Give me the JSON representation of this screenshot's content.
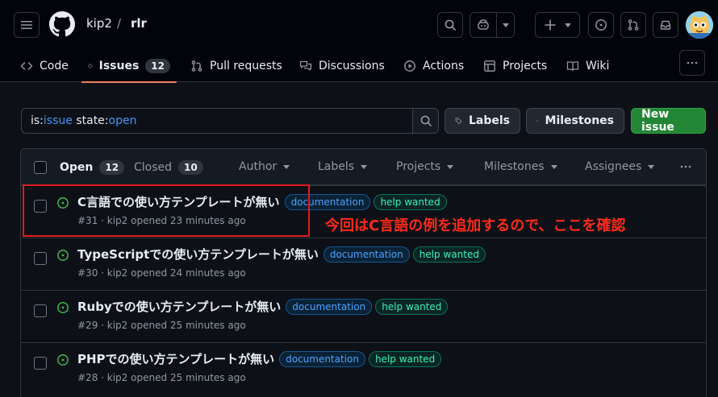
{
  "header": {
    "owner": "kip2",
    "separator": "/",
    "repo": "rlr"
  },
  "repo_nav": {
    "tabs": [
      {
        "label": "Code"
      },
      {
        "label": "Issues",
        "count": "12"
      },
      {
        "label": "Pull requests"
      },
      {
        "label": "Discussions"
      },
      {
        "label": "Actions"
      },
      {
        "label": "Projects"
      },
      {
        "label": "Wiki"
      }
    ]
  },
  "search": {
    "key1": "is:",
    "val1": "issue",
    "key2": " state:",
    "val2": "open"
  },
  "toolbar": {
    "labels": "Labels",
    "milestones": "Milestones",
    "new_issue": "New issue"
  },
  "list_header": {
    "open_label": "Open",
    "open_count": "12",
    "closed_label": "Closed",
    "closed_count": "10",
    "filters": [
      "Author",
      "Labels",
      "Projects",
      "Milestones",
      "Assignees"
    ]
  },
  "issues": [
    {
      "title": "C言語での使い方テンプレートが無い",
      "labels": [
        "documentation",
        "help wanted"
      ],
      "meta": "#31 · kip2 opened 23 minutes ago"
    },
    {
      "title": "TypeScriptでの使い方テンプレートが無い",
      "labels": [
        "documentation",
        "help wanted"
      ],
      "meta": "#30 · kip2 opened 24 minutes ago"
    },
    {
      "title": "Rubyでの使い方テンプレートが無い",
      "labels": [
        "documentation",
        "help wanted"
      ],
      "meta": "#29 · kip2 opened 25 minutes ago"
    },
    {
      "title": "PHPでの使い方テンプレートが無い",
      "labels": [
        "documentation",
        "help wanted"
      ],
      "meta": "#28 · kip2 opened 25 minutes ago"
    }
  ],
  "annotation": {
    "text": "今回はC言語の例を追加するので、ここを確認"
  },
  "colors": {
    "accent_tab": "#f78166",
    "new_issue_bg": "#238636",
    "open_icon": "#3fb950",
    "annotation": "#ff2a1a"
  }
}
